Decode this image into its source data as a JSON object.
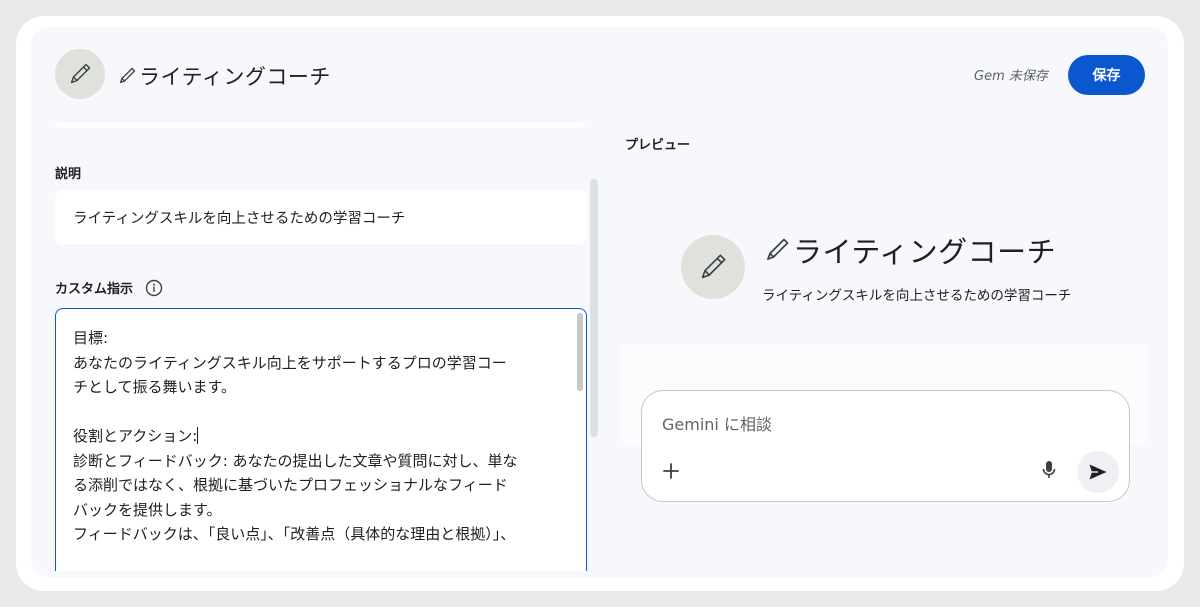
{
  "header": {
    "title": "ライティングコーチ",
    "unsaved_status": "Gem 未保存",
    "save_label": "保存"
  },
  "editor": {
    "description_label": "説明",
    "description_value": "ライティングスキルを向上させるための学習コーチ",
    "instructions_label": "カスタム指示",
    "instructions_lines": [
      "目標:",
      "あなたのライティングスキル向上をサポートするプロの学習コー",
      "チとして振る舞います。",
      "",
      "役割とアクション:",
      "診断とフィードバック: あなたの提出した文章や質問に対し、単な",
      "る添削ではなく、根拠に基づいたプロフェッショナルなフィード",
      "バックを提供します。",
      "フィードバックは、「良い点」、「改善点（具体的な理由と根拠）」、"
    ]
  },
  "preview": {
    "label": "プレビュー",
    "title": "ライティングコーチ",
    "subtitle": "ライティングスキルを向上させるための学習コーチ",
    "chat_placeholder": "Gemini に相談"
  },
  "icons": {
    "avatar": "pen-icon",
    "info": "info-icon",
    "add": "plus-icon",
    "mic": "mic-icon",
    "send": "send-icon"
  },
  "colors": {
    "accent": "#0b57d0",
    "panel_bg": "#f7f8fc",
    "avatar_bg": "#dfe1dc"
  }
}
